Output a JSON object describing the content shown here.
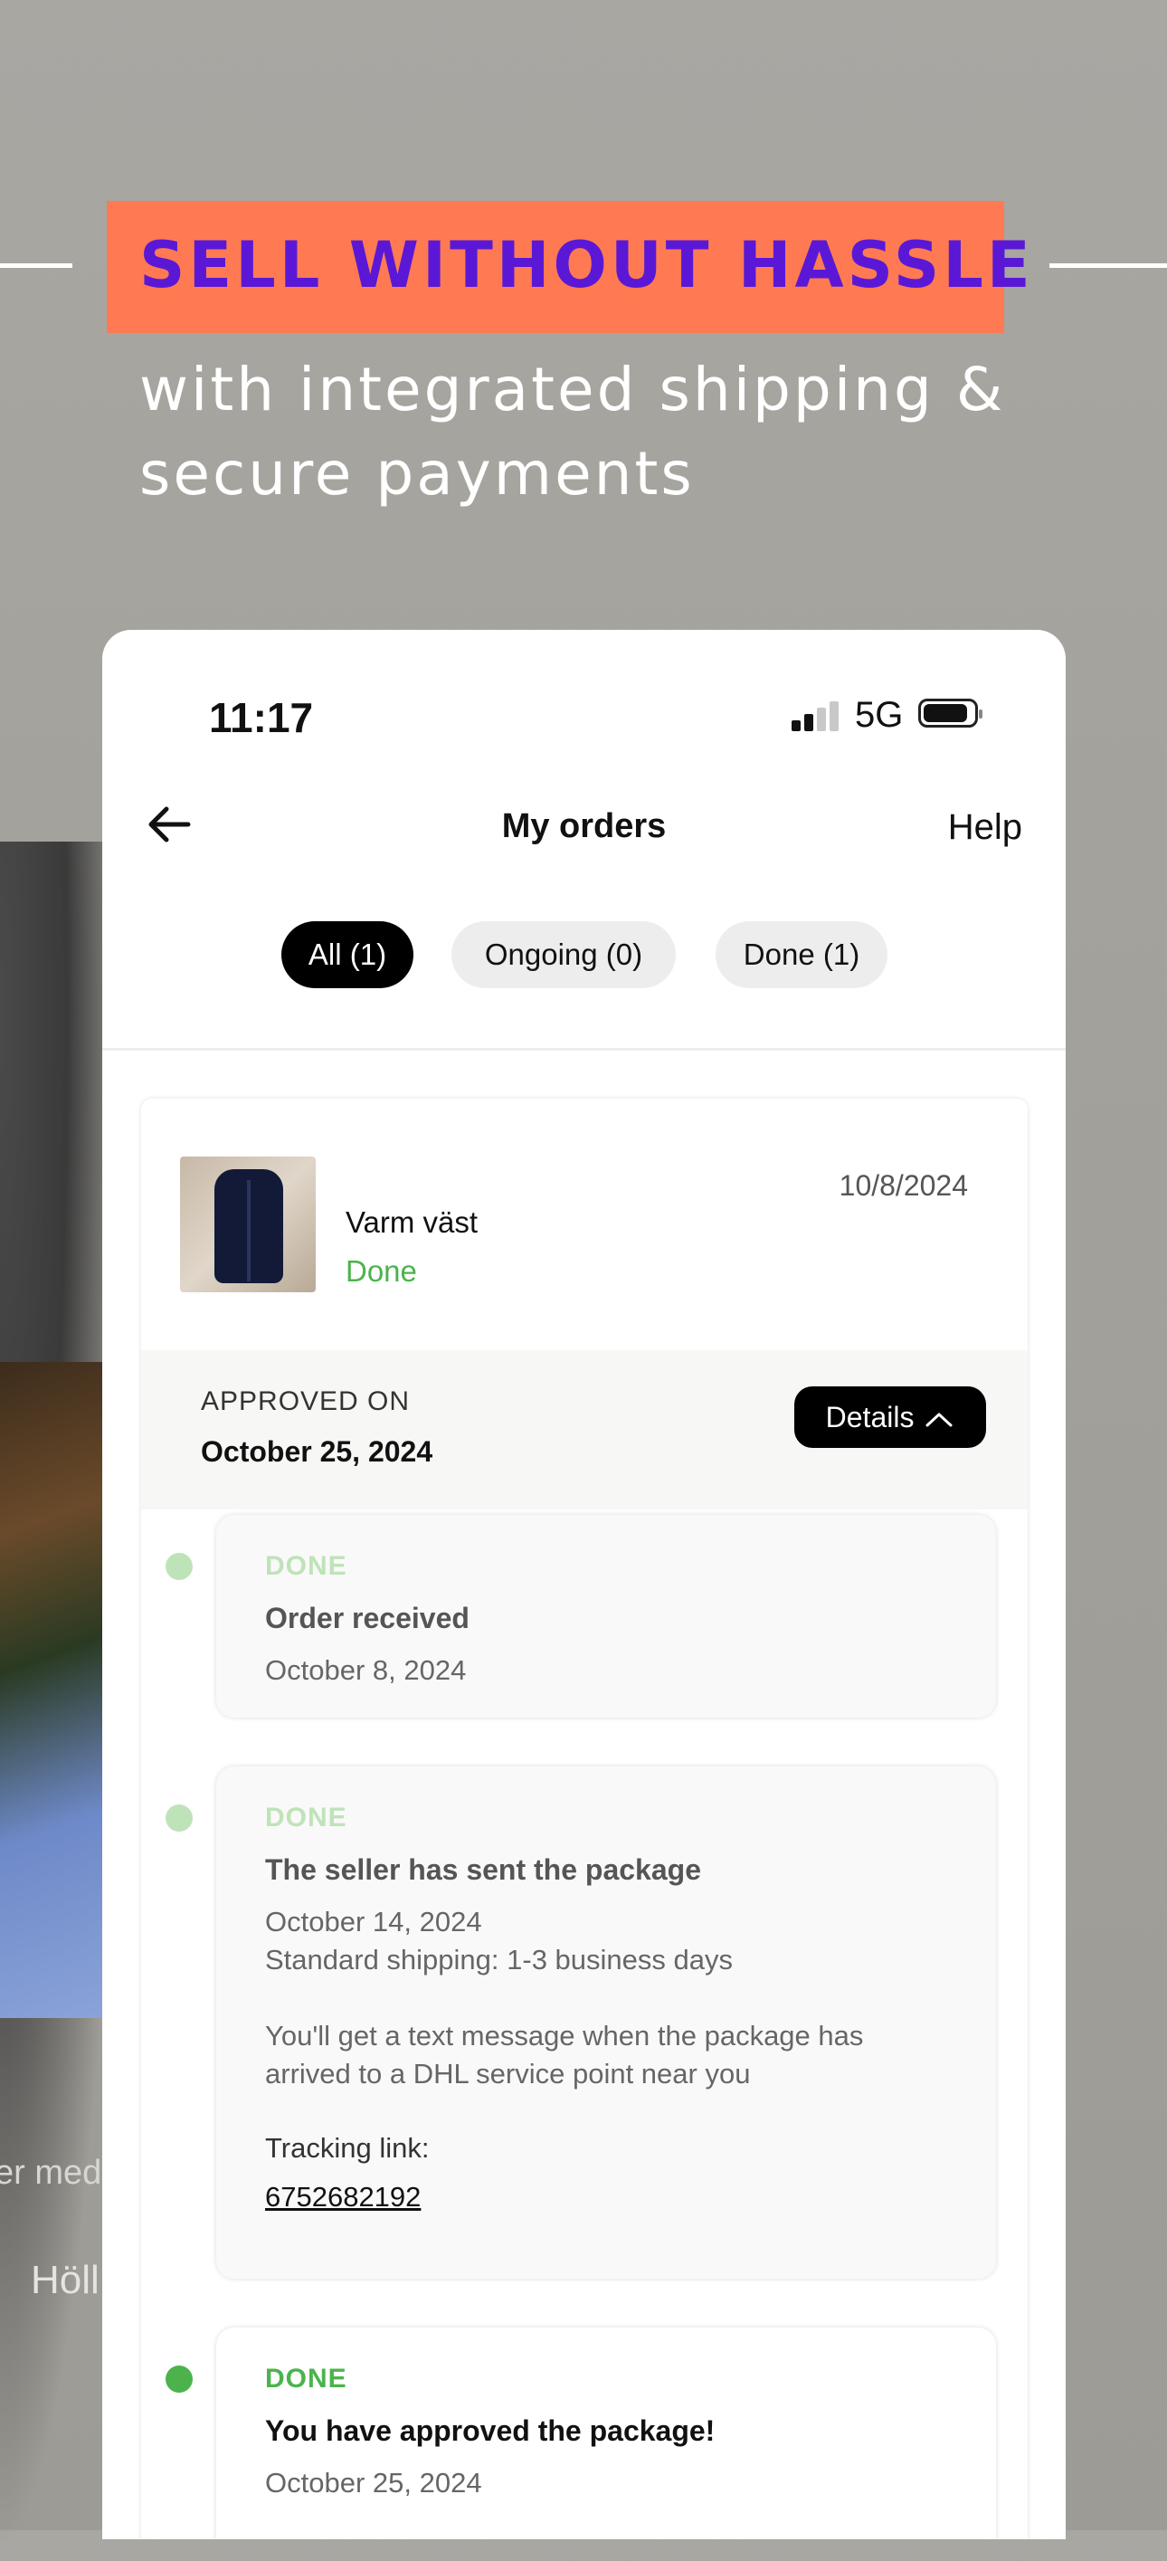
{
  "promo": {
    "headline": "SELL WITHOUT HASSLE",
    "subline1": "with integrated shipping &",
    "subline2": "secure payments"
  },
  "background": {
    "text1": "er med",
    "text2": "Höll"
  },
  "status_bar": {
    "time": "11:17",
    "network": "5G"
  },
  "nav": {
    "title": "My orders",
    "help": "Help"
  },
  "filters": [
    {
      "label": "All (1)",
      "active": true
    },
    {
      "label": "Ongoing (0)",
      "active": false
    },
    {
      "label": "Done (1)",
      "active": false
    }
  ],
  "order": {
    "item_name": "Varm väst",
    "status": "Done",
    "date": "10/8/2024",
    "approved_label": "APPROVED ON",
    "approved_date": "October 25, 2024",
    "details_label": "Details"
  },
  "timeline": [
    {
      "status": "DONE",
      "title": "Order received",
      "date": "October 8, 2024"
    },
    {
      "status": "DONE",
      "title": "The seller has sent the package",
      "date": "October 14, 2024",
      "shipping": "Standard shipping: 1-3 business days",
      "note1": "You'll get a text message when the package has",
      "note2": "arrived to a DHL service point near you",
      "tracking_label": "Tracking link:",
      "tracking_number": "6752682192"
    },
    {
      "status": "DONE",
      "title": "You have approved the package!",
      "date": "October 25, 2024"
    }
  ],
  "colors": {
    "headline_bg": "#ff7a52",
    "headline_text": "#5a18d6",
    "done_green": "#4cb34c",
    "faded_green": "#bfe3b9"
  }
}
